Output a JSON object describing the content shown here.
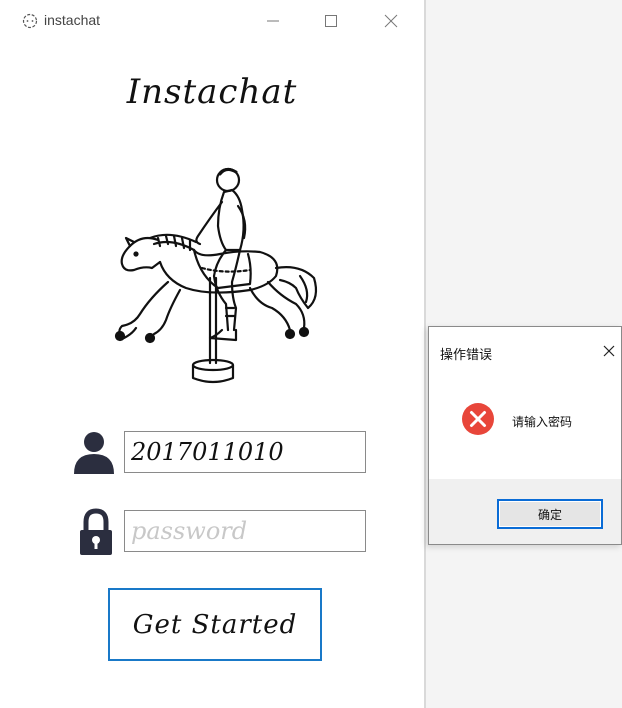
{
  "window": {
    "title": "instachat",
    "heading": "Instachat"
  },
  "form": {
    "username_value": "2017011010",
    "password_placeholder": "password",
    "submit_label": "Get Started"
  },
  "dialog": {
    "title": "操作错误",
    "message": "请输入密码",
    "ok_label": "确定"
  },
  "colors": {
    "accent": "#1979c8",
    "error": "#e8463a",
    "icon_dark": "#2b2e3f"
  }
}
